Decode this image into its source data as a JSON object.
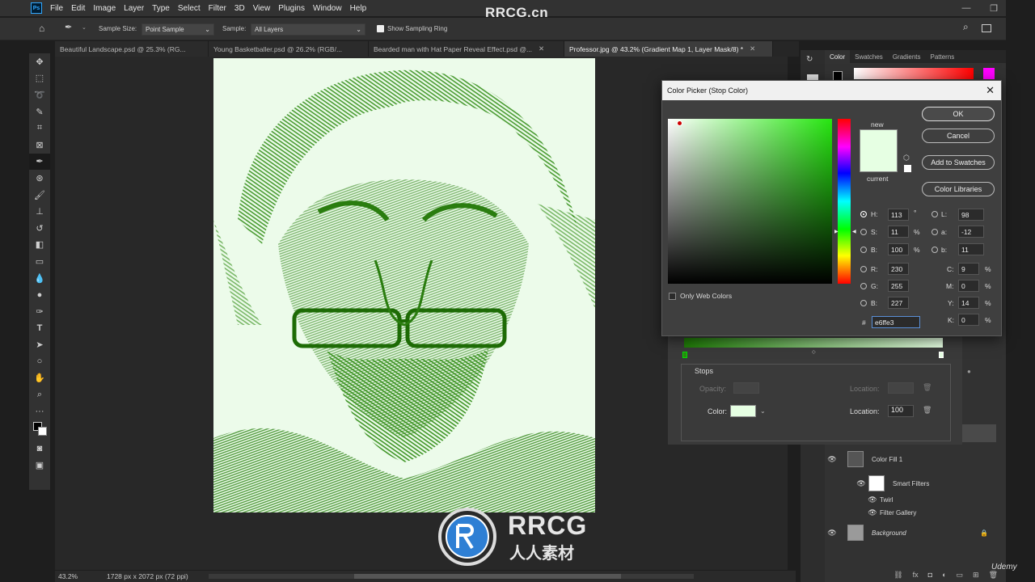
{
  "brand": {
    "watermark_top": "RRCG.cn",
    "logo_text": "RRCG",
    "logo_sub": "人人素材",
    "udemy": "Udemy"
  },
  "menubar": {
    "items": [
      "File",
      "Edit",
      "Image",
      "Layer",
      "Type",
      "Select",
      "Filter",
      "3D",
      "View",
      "Plugins",
      "Window",
      "Help"
    ]
  },
  "options": {
    "sample_size_label": "Sample Size:",
    "sample_size_value": "Point Sample",
    "sample_label": "Sample:",
    "sample_value": "All Layers",
    "sampling_ring_label": "Show Sampling Ring"
  },
  "tabs": [
    {
      "label": "Beautiful Landscape.psd @ 25.3% (RG..."
    },
    {
      "label": "Young Basketballer.psd @ 26.2% (RGB/..."
    },
    {
      "label": "Bearded man with Hat Paper Reveal Effect.psd @..."
    },
    {
      "label": "Professor.jpg @ 43.2% (Gradient Map 1, Layer Mask/8) *"
    }
  ],
  "status": {
    "zoom": "43.2%",
    "doc_info": "1728 px x 2072 px (72 ppi)"
  },
  "panel_tabs": [
    "Color",
    "Swatches",
    "Gradients",
    "Patterns"
  ],
  "color_picker": {
    "title": "Color Picker (Stop Color)",
    "new_label": "new",
    "current_label": "current",
    "ok": "OK",
    "cancel": "Cancel",
    "add_swatches": "Add to Swatches",
    "color_libraries": "Color Libraries",
    "only_web": "Only Web Colors",
    "hsb": {
      "H": "113",
      "S": "11",
      "B": "100"
    },
    "hsb_units": {
      "H": "°",
      "S": "%",
      "B": "%"
    },
    "rgb": {
      "R": "230",
      "G": "255",
      "B": "227"
    },
    "lab": {
      "L": "98",
      "a": "-12",
      "b": "11"
    },
    "cmyk": {
      "C": "9",
      "M": "0",
      "Y": "14",
      "K": "0"
    },
    "cmyk_unit": "%",
    "hex_label": "#",
    "hex": "e6ffe3",
    "new_color": "#e6ffe3"
  },
  "gradient_editor": {
    "stops_label": "Stops",
    "opacity_label": "Opacity:",
    "location_label": "Location:",
    "color_label": "Color:",
    "location_value": "100"
  },
  "layers": [
    {
      "name": "Color Fill 1"
    },
    {
      "name": "Smart Filters"
    },
    {
      "name": "Twirl"
    },
    {
      "name": "Filter Gallery"
    },
    {
      "name": "Background"
    }
  ]
}
